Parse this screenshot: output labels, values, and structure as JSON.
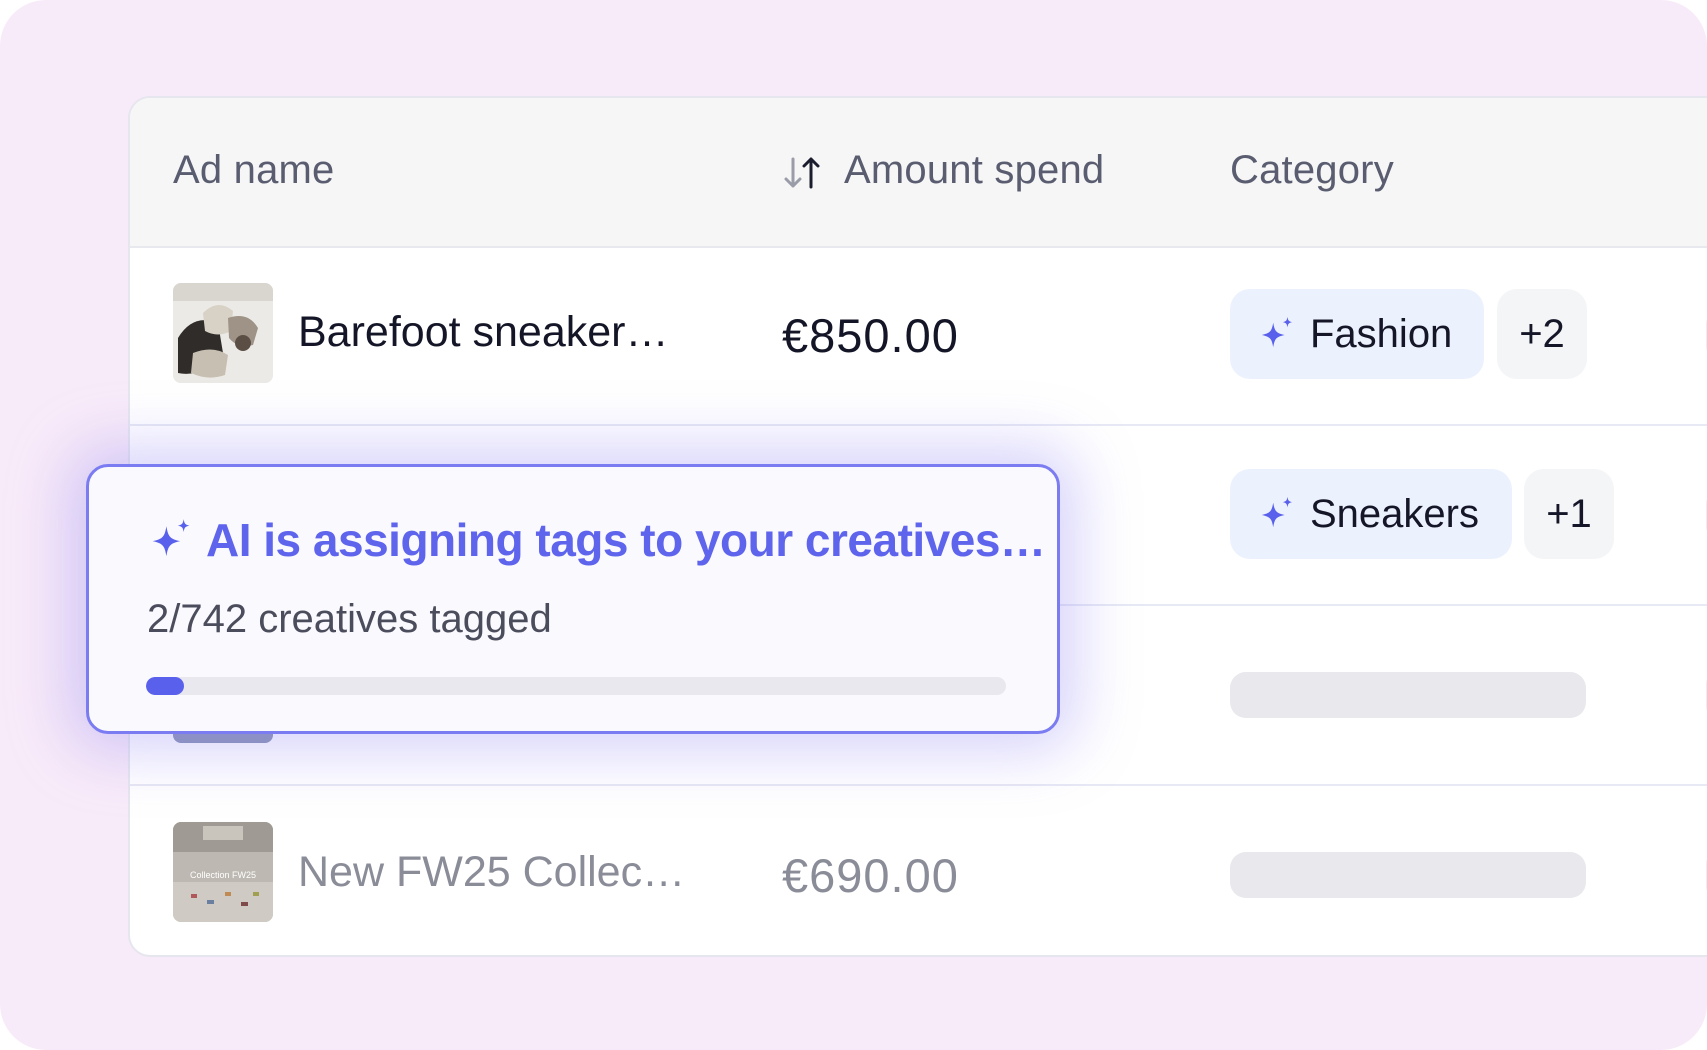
{
  "table": {
    "columns": [
      "Ad name",
      "Amount spend",
      "Category"
    ],
    "rows": [
      {
        "name": "Barefoot sneaker…",
        "amount": "€850.00",
        "tags": [
          "Fashion"
        ],
        "more": "+2"
      },
      {
        "name": "",
        "amount": "",
        "tags": [
          "Sneakers"
        ],
        "more": "+1"
      },
      {
        "name": "",
        "amount": "",
        "tags": [],
        "more": ""
      },
      {
        "name": "New FW25 Collec…",
        "amount": "€690.00",
        "tags": [],
        "more": ""
      }
    ],
    "thumb_text": {
      "row4": "Collection FW25"
    }
  },
  "toast": {
    "title": "AI is assigning tags to your creatives…",
    "status": "2/742 creatives tagged",
    "progress_fraction": 0.0027
  },
  "colors": {
    "background": "#f8ebf9",
    "accent": "#5e64ec",
    "tag_bg": "#ecf2fd"
  },
  "icons": {
    "sort": "sort-arrows-icon",
    "sparkle": "sparkle-icon"
  }
}
